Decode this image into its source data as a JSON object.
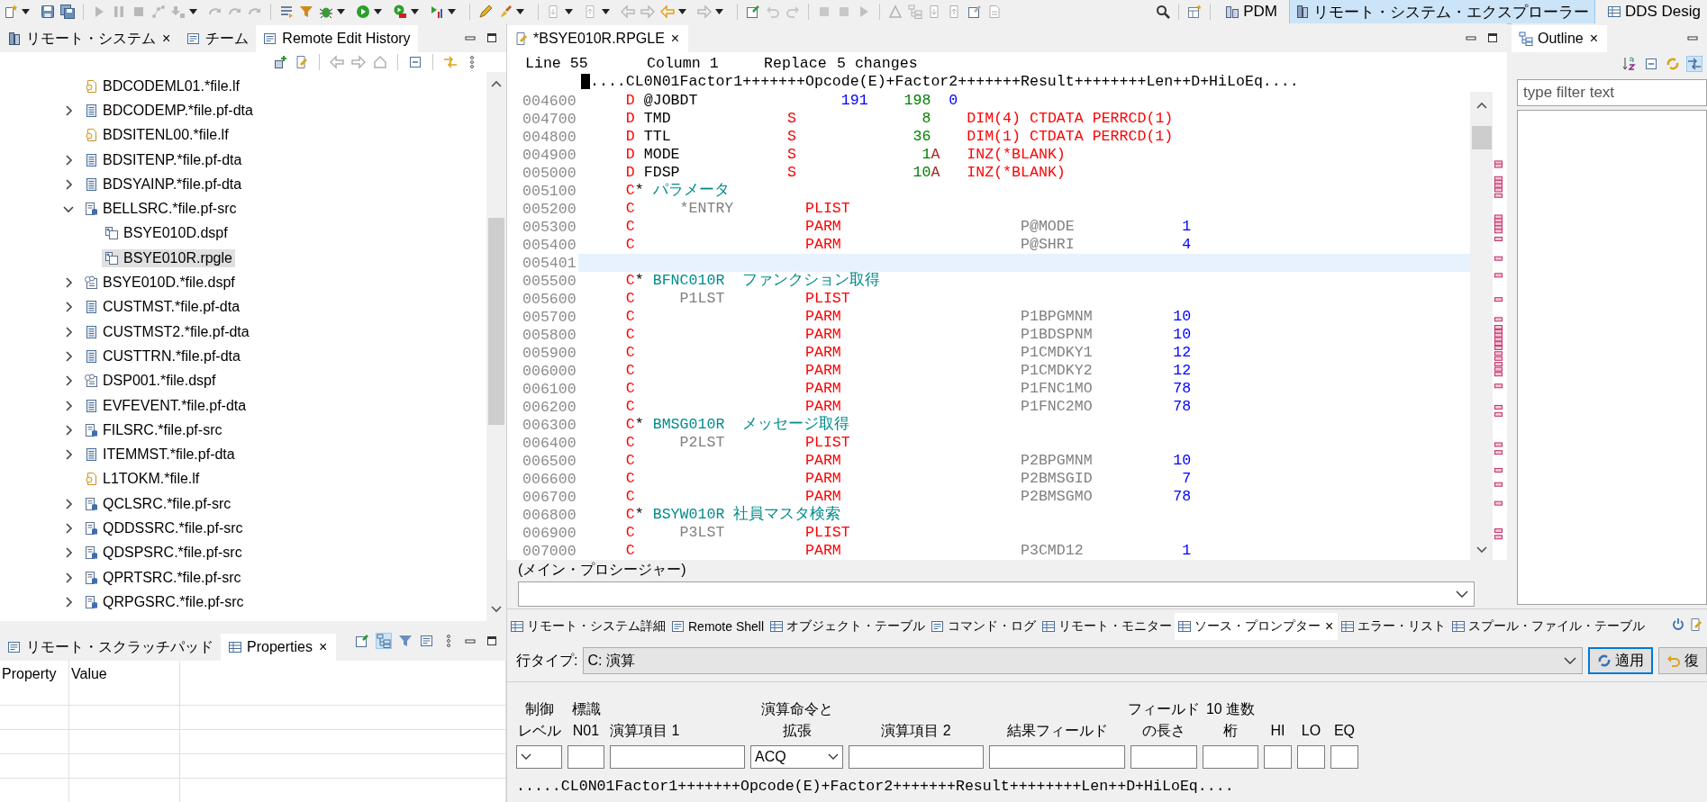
{
  "toolbar": {
    "perspectives": [
      {
        "label": "PDM",
        "selected": false
      },
      {
        "label": "リモート・システム・エクスプローラー",
        "selected": true
      },
      {
        "label": "DDS Desig",
        "selected": false
      }
    ]
  },
  "remote_systems_view": {
    "tabs": [
      {
        "label": "リモート・システム",
        "selected": false,
        "close": "×"
      },
      {
        "label": "チーム",
        "selected": false
      },
      {
        "label": "Remote Edit History",
        "selected": true
      }
    ],
    "tree": [
      {
        "label": "BDCODEML01.*file.lf",
        "kind": "lf",
        "expandable": false,
        "expanded": false,
        "selected": false
      },
      {
        "label": "BDCODEMP.*file.pf-dta",
        "kind": "pf-dta",
        "expandable": true,
        "expanded": false,
        "selected": false
      },
      {
        "label": "BDSITENL00.*file.lf",
        "kind": "lf",
        "expandable": false,
        "expanded": false,
        "selected": false
      },
      {
        "label": "BDSITENP.*file.pf-dta",
        "kind": "pf-dta",
        "expandable": true,
        "expanded": false,
        "selected": false
      },
      {
        "label": "BDSYAINP.*file.pf-dta",
        "kind": "pf-dta",
        "expandable": true,
        "expanded": false,
        "selected": false
      },
      {
        "label": "BELLSRC.*file.pf-src",
        "kind": "pf-src",
        "expandable": true,
        "expanded": true,
        "selected": false,
        "children": [
          {
            "label": "BSYE010D.dspf",
            "kind": "member",
            "expandable": false,
            "expanded": false,
            "selected": false
          },
          {
            "label": "BSYE010R.rpgle",
            "kind": "member",
            "expandable": false,
            "expanded": false,
            "selected": true
          }
        ]
      },
      {
        "label": "BSYE010D.*file.dspf",
        "kind": "dspf",
        "expandable": true,
        "expanded": false,
        "selected": false
      },
      {
        "label": "CUSTMST.*file.pf-dta",
        "kind": "pf-dta",
        "expandable": true,
        "expanded": false,
        "selected": false
      },
      {
        "label": "CUSTMST2.*file.pf-dta",
        "kind": "pf-dta",
        "expandable": true,
        "expanded": false,
        "selected": false
      },
      {
        "label": "CUSTTRN.*file.pf-dta",
        "kind": "pf-dta",
        "expandable": true,
        "expanded": false,
        "selected": false
      },
      {
        "label": "DSP001.*file.dspf",
        "kind": "dspf",
        "expandable": true,
        "expanded": false,
        "selected": false
      },
      {
        "label": "EVFEVENT.*file.pf-dta",
        "kind": "pf-dta",
        "expandable": true,
        "expanded": false,
        "selected": false
      },
      {
        "label": "FILSRC.*file.pf-src",
        "kind": "pf-src",
        "expandable": true,
        "expanded": false,
        "selected": false
      },
      {
        "label": "ITEMMST.*file.pf-dta",
        "kind": "pf-dta",
        "expandable": true,
        "expanded": false,
        "selected": false
      },
      {
        "label": "L1TOKM.*file.lf",
        "kind": "lf",
        "expandable": false,
        "expanded": false,
        "selected": false
      },
      {
        "label": "QCLSRC.*file.pf-src",
        "kind": "pf-src",
        "expandable": true,
        "expanded": false,
        "selected": false
      },
      {
        "label": "QDDSSRC.*file.pf-src",
        "kind": "pf-src",
        "expandable": true,
        "expanded": false,
        "selected": false
      },
      {
        "label": "QDSPSRC.*file.pf-src",
        "kind": "pf-src",
        "expandable": true,
        "expanded": false,
        "selected": false
      },
      {
        "label": "QPRTSRC.*file.pf-src",
        "kind": "pf-src",
        "expandable": true,
        "expanded": false,
        "selected": false
      },
      {
        "label": "QRPGSRC.*file.pf-src",
        "kind": "pf-src",
        "expandable": true,
        "expanded": false,
        "selected": false
      }
    ]
  },
  "properties_view": {
    "tabs": [
      {
        "label": "リモート・スクラッチパッド",
        "selected": false
      },
      {
        "label": "Properties",
        "selected": true,
        "close": "×"
      }
    ],
    "columns": [
      "Property",
      "Value"
    ]
  },
  "editor": {
    "tab": {
      "label": "*BSYE010R.RPGLE",
      "close": "×"
    },
    "status": [
      "Line 55",
      "Column 1",
      "Replace",
      "5 changes"
    ],
    "ruler": "....CL0N01Factor1+++++++Opcode(E)+Factor2+++++++Result++++++++Len++D+HiLoEq....",
    "lines": [
      {
        "number": "004600",
        "current": false,
        "tokens": [
          {
            "text": "     D",
            "kind": "spec"
          },
          {
            "text": " @JOBDT",
            "kind": "name"
          },
          {
            "text": "                191",
            "kind": "blue"
          },
          {
            "text": "    198",
            "kind": "green"
          },
          {
            "text": "  0",
            "kind": "blue"
          }
        ]
      },
      {
        "number": "004700",
        "current": false,
        "tokens": [
          {
            "text": "     D",
            "kind": "spec"
          },
          {
            "text": " TMD",
            "kind": "name"
          },
          {
            "text": "             S",
            "kind": "spec"
          },
          {
            "text": "              8",
            "kind": "green"
          },
          {
            "text": "    DIM(4) CTDATA PERRCD(1)",
            "kind": "keyword"
          }
        ]
      },
      {
        "number": "004800",
        "current": false,
        "tokens": [
          {
            "text": "     D",
            "kind": "spec"
          },
          {
            "text": " TTL",
            "kind": "name"
          },
          {
            "text": "             S",
            "kind": "spec"
          },
          {
            "text": "             36",
            "kind": "green"
          },
          {
            "text": "    DIM(1) CTDATA PERRCD(1)",
            "kind": "keyword"
          }
        ]
      },
      {
        "number": "004900",
        "current": false,
        "tokens": [
          {
            "text": "     D",
            "kind": "spec"
          },
          {
            "text": " MODE",
            "kind": "name"
          },
          {
            "text": "            S",
            "kind": "spec"
          },
          {
            "text": "              1",
            "kind": "green"
          },
          {
            "text": "A",
            "kind": "datatype"
          },
          {
            "text": "   INZ(*BLANK)",
            "kind": "keyword"
          }
        ]
      },
      {
        "number": "005000",
        "current": false,
        "tokens": [
          {
            "text": "     D",
            "kind": "spec"
          },
          {
            "text": " FDSP",
            "kind": "name"
          },
          {
            "text": "            S",
            "kind": "spec"
          },
          {
            "text": "             10",
            "kind": "green"
          },
          {
            "text": "A",
            "kind": "datatype"
          },
          {
            "text": "   INZ(*BLANK)",
            "kind": "keyword"
          }
        ]
      },
      {
        "number": "005100",
        "current": false,
        "tokens": [
          {
            "text": "     C",
            "kind": "spec"
          },
          {
            "text": "*",
            "kind": "star"
          },
          {
            "text": " パラメータ",
            "kind": "comment"
          }
        ]
      },
      {
        "number": "005200",
        "current": false,
        "tokens": [
          {
            "text": "     C",
            "kind": "spec"
          },
          {
            "text": "     *ENTRY",
            "kind": "factor"
          },
          {
            "text": "        PLIST",
            "kind": "opcode"
          }
        ]
      },
      {
        "number": "005300",
        "current": false,
        "tokens": [
          {
            "text": "     C",
            "kind": "spec"
          },
          {
            "text": "                   PARM",
            "kind": "opcode"
          },
          {
            "text": "                    P@MODE",
            "kind": "result"
          },
          {
            "text": "            1",
            "kind": "blue"
          }
        ]
      },
      {
        "number": "005400",
        "current": false,
        "tokens": [
          {
            "text": "     C",
            "kind": "spec"
          },
          {
            "text": "                   PARM",
            "kind": "opcode"
          },
          {
            "text": "                    P@SHRI",
            "kind": "result"
          },
          {
            "text": "            4",
            "kind": "blue"
          }
        ]
      },
      {
        "number": "005401",
        "current": true
      },
      {
        "number": "005500",
        "current": false,
        "tokens": [
          {
            "text": "     C",
            "kind": "spec"
          },
          {
            "text": "*",
            "kind": "star"
          },
          {
            "text": " BFNC010R  ファンクション取得",
            "kind": "comment"
          }
        ]
      },
      {
        "number": "005600",
        "current": false,
        "tokens": [
          {
            "text": "     C",
            "kind": "spec"
          },
          {
            "text": "     P1LST",
            "kind": "factor"
          },
          {
            "text": "         PLIST",
            "kind": "opcode"
          }
        ]
      },
      {
        "number": "005700",
        "current": false,
        "tokens": [
          {
            "text": "     C",
            "kind": "spec"
          },
          {
            "text": "                   PARM",
            "kind": "opcode"
          },
          {
            "text": "                    P1BPGMNM",
            "kind": "result"
          },
          {
            "text": "         10",
            "kind": "blue"
          }
        ]
      },
      {
        "number": "005800",
        "current": false,
        "tokens": [
          {
            "text": "     C",
            "kind": "spec"
          },
          {
            "text": "                   PARM",
            "kind": "opcode"
          },
          {
            "text": "                    P1BDSPNM",
            "kind": "result"
          },
          {
            "text": "         10",
            "kind": "blue"
          }
        ]
      },
      {
        "number": "005900",
        "current": false,
        "tokens": [
          {
            "text": "     C",
            "kind": "spec"
          },
          {
            "text": "                   PARM",
            "kind": "opcode"
          },
          {
            "text": "                    P1CMDKY1",
            "kind": "result"
          },
          {
            "text": "         12",
            "kind": "blue"
          }
        ]
      },
      {
        "number": "006000",
        "current": false,
        "tokens": [
          {
            "text": "     C",
            "kind": "spec"
          },
          {
            "text": "                   PARM",
            "kind": "opcode"
          },
          {
            "text": "                    P1CMDKY2",
            "kind": "result"
          },
          {
            "text": "         12",
            "kind": "blue"
          }
        ]
      },
      {
        "number": "006100",
        "current": false,
        "tokens": [
          {
            "text": "     C",
            "kind": "spec"
          },
          {
            "text": "                   PARM",
            "kind": "opcode"
          },
          {
            "text": "                    P1FNC1MO",
            "kind": "result"
          },
          {
            "text": "         78",
            "kind": "blue"
          }
        ]
      },
      {
        "number": "006200",
        "current": false,
        "tokens": [
          {
            "text": "     C",
            "kind": "spec"
          },
          {
            "text": "                   PARM",
            "kind": "opcode"
          },
          {
            "text": "                    P1FNC2MO",
            "kind": "result"
          },
          {
            "text": "         78",
            "kind": "blue"
          }
        ]
      },
      {
        "number": "006300",
        "current": false,
        "tokens": [
          {
            "text": "     C",
            "kind": "spec"
          },
          {
            "text": "*",
            "kind": "star"
          },
          {
            "text": " BMSG010R  メッセージ取得",
            "kind": "comment"
          }
        ]
      },
      {
        "number": "006400",
        "current": false,
        "tokens": [
          {
            "text": "     C",
            "kind": "spec"
          },
          {
            "text": "     P2LST",
            "kind": "factor"
          },
          {
            "text": "         PLIST",
            "kind": "opcode"
          }
        ]
      },
      {
        "number": "006500",
        "current": false,
        "tokens": [
          {
            "text": "     C",
            "kind": "spec"
          },
          {
            "text": "                   PARM",
            "kind": "opcode"
          },
          {
            "text": "                    P2BPGMNM",
            "kind": "result"
          },
          {
            "text": "         10",
            "kind": "blue"
          }
        ]
      },
      {
        "number": "006600",
        "current": false,
        "tokens": [
          {
            "text": "     C",
            "kind": "spec"
          },
          {
            "text": "                   PARM",
            "kind": "opcode"
          },
          {
            "text": "                    P2BMSGID",
            "kind": "result"
          },
          {
            "text": "          7",
            "kind": "blue"
          }
        ]
      },
      {
        "number": "006700",
        "current": false,
        "tokens": [
          {
            "text": "     C",
            "kind": "spec"
          },
          {
            "text": "                   PARM",
            "kind": "opcode"
          },
          {
            "text": "                    P2BMSGMO",
            "kind": "result"
          },
          {
            "text": "         78",
            "kind": "blue"
          }
        ]
      },
      {
        "number": "006800",
        "current": false,
        "tokens": [
          {
            "text": "     C",
            "kind": "spec"
          },
          {
            "text": "*",
            "kind": "star"
          },
          {
            "text": " BSYW010R 社員マスタ検索",
            "kind": "comment"
          }
        ]
      },
      {
        "number": "006900",
        "current": false,
        "tokens": [
          {
            "text": "     C",
            "kind": "spec"
          },
          {
            "text": "     P3LST",
            "kind": "factor"
          },
          {
            "text": "         PLIST",
            "kind": "opcode"
          }
        ]
      },
      {
        "number": "007000",
        "current": false,
        "tokens": [
          {
            "text": "     C",
            "kind": "spec"
          },
          {
            "text": "                   PARM",
            "kind": "opcode"
          },
          {
            "text": "                    P3CMD12",
            "kind": "result"
          },
          {
            "text": "           1",
            "kind": "blue"
          }
        ]
      }
    ],
    "procedure": "(メイン・プロシージャー)"
  },
  "outline": {
    "tab": {
      "label": "Outline",
      "close": "×"
    },
    "filter": {
      "placeholder": "type filter text"
    }
  },
  "bottom_panel": {
    "tabs": [
      {
        "label": "リモート・システム詳細",
        "selected": false
      },
      {
        "label": "Remote Shell",
        "selected": false
      },
      {
        "label": "オブジェクト・テーブル",
        "selected": false
      },
      {
        "label": "コマンド・ログ",
        "selected": false
      },
      {
        "label": "リモート・モニター",
        "selected": false
      },
      {
        "label": "ソース・プロンプター",
        "selected": true,
        "close": "×"
      },
      {
        "label": "エラー・リスト",
        "selected": false
      },
      {
        "label": "スプール・ファイル・テーブル",
        "selected": false
      }
    ],
    "row_type": {
      "label": "行タイプ:",
      "value": "C: 演算"
    },
    "buttons": [
      {
        "label": "適用",
        "focused": true
      },
      {
        "label": "復",
        "focused": false
      }
    ],
    "fields": [
      {
        "label_lines": [
          "制御",
          "レベル"
        ],
        "kind": "select"
      },
      {
        "label_lines": [
          "標識",
          "N01"
        ],
        "kind": "input"
      },
      {
        "label_lines": [
          "演算項目 1"
        ],
        "kind": "input"
      },
      {
        "label_lines": [
          "演算命令と",
          "拡張"
        ],
        "kind": "select",
        "value": "ACQ"
      },
      {
        "label_lines": [
          "演算項目 2"
        ],
        "kind": "input"
      },
      {
        "label_lines": [
          "結果フィールド"
        ],
        "kind": "input"
      },
      {
        "label_lines": [
          "フィールド",
          "の長さ"
        ],
        "kind": "input"
      },
      {
        "label_lines": [
          "10 進数",
          "桁"
        ],
        "kind": "input"
      },
      {
        "label_lines": [
          "HI"
        ],
        "kind": "input"
      },
      {
        "label_lines": [
          "LO"
        ],
        "kind": "input"
      },
      {
        "label_lines": [
          "EQ"
        ],
        "kind": "input"
      }
    ],
    "ruler": ".....CL0N01Factor1+++++++Opcode(E)+Factor2+++++++Result++++++++Len++D+HiLoEq...."
  }
}
